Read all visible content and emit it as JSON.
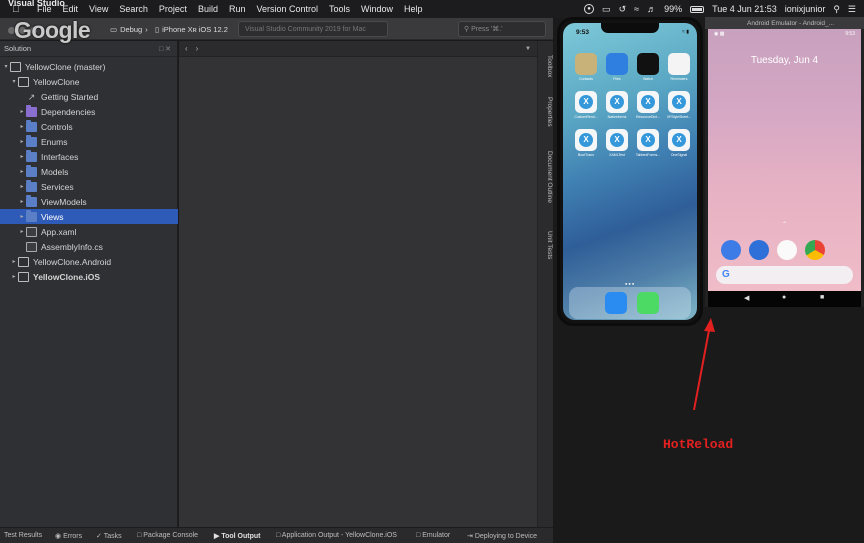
{
  "menubar": {
    "apple_icon": "apple-icon",
    "items": [
      "Visual Studio",
      "File",
      "Edit",
      "View",
      "Search",
      "Project",
      "Build",
      "Run",
      "Version Control",
      "Tools",
      "Window",
      "Help"
    ],
    "battery_percent": "99%",
    "clock": "Tue 4 Jun  21:53",
    "user": "ionixjunior"
  },
  "overlay_logo": "Google",
  "toolbar": {
    "configuration": "Debug",
    "device": "iPhone Xʀ iOS 12.2",
    "status_text": "Visual Studio Community 2019 for Mac",
    "search_placeholder": "Press '⌘.'"
  },
  "solution_pad": {
    "title": "Solution",
    "tree": [
      {
        "label": "YellowClone (master)",
        "depth": 0,
        "arrow": "▾",
        "icon": "solution-icon"
      },
      {
        "label": "YellowClone",
        "depth": 1,
        "arrow": "▾",
        "icon": "project-icon"
      },
      {
        "label": "Getting Started",
        "depth": 2,
        "arrow": "",
        "icon": "rocket-icon"
      },
      {
        "label": "Dependencies",
        "depth": 2,
        "arrow": "▸",
        "icon": "dependencies-icon"
      },
      {
        "label": "Controls",
        "depth": 2,
        "arrow": "▸",
        "icon": "folder-icon"
      },
      {
        "label": "Enums",
        "depth": 2,
        "arrow": "▸",
        "icon": "folder-icon"
      },
      {
        "label": "Interfaces",
        "depth": 2,
        "arrow": "▸",
        "icon": "folder-icon"
      },
      {
        "label": "Models",
        "depth": 2,
        "arrow": "▸",
        "icon": "folder-icon"
      },
      {
        "label": "Services",
        "depth": 2,
        "arrow": "▸",
        "icon": "folder-icon"
      },
      {
        "label": "ViewModels",
        "depth": 2,
        "arrow": "▸",
        "icon": "folder-icon"
      },
      {
        "label": "Views",
        "depth": 2,
        "arrow": "▸",
        "icon": "folder-icon",
        "selected": true
      },
      {
        "label": "App.xaml",
        "depth": 2,
        "arrow": "▸",
        "icon": "xaml-file-icon"
      },
      {
        "label": "AssemblyInfo.cs",
        "depth": 2,
        "arrow": "",
        "icon": "cs-file-icon"
      },
      {
        "label": "YellowClone.Android",
        "depth": 1,
        "arrow": "▸",
        "icon": "project-icon"
      },
      {
        "label": "YellowClone.iOS",
        "depth": 1,
        "arrow": "▸",
        "icon": "project-icon",
        "bold": true
      }
    ]
  },
  "side_tabs": [
    "Toolbox",
    "Properties",
    "Document Outline",
    "Unit Tests"
  ],
  "status_bar": {
    "items": [
      "Test Results",
      "Errors",
      "Tasks",
      "Package Console",
      "Tool Output",
      "Application Output - YellowClone.iOS",
      "Emulator",
      "Deploying to Device"
    ]
  },
  "iphone": {
    "time": "9:53",
    "apps": [
      {
        "label": "Contacts",
        "color": "#c8b27a"
      },
      {
        "label": "Files",
        "color": "#2f7fe0"
      },
      {
        "label": "Watch",
        "color": "#111111"
      },
      {
        "label": "Reminders",
        "color": "#f4f4f4"
      },
      {
        "label": "CustomRend...",
        "color": "xam"
      },
      {
        "label": "Nativeforms",
        "color": "xam"
      },
      {
        "label": "ResourceDict...",
        "color": "xam"
      },
      {
        "label": "XFStyleSheet...",
        "color": "xam"
      },
      {
        "label": "BootTrans",
        "color": "xam"
      },
      {
        "label": "XAMLTest",
        "color": "xam"
      },
      {
        "label": "TabbedForms...",
        "color": "xam"
      },
      {
        "label": "OneSignal",
        "color": "xam"
      }
    ]
  },
  "android": {
    "window_title": "Android Emulator - Android_...",
    "time": "9:53",
    "date": "Tuesday, Jun 4"
  },
  "annotation": {
    "label": "HotReload",
    "color": "#e22020"
  }
}
